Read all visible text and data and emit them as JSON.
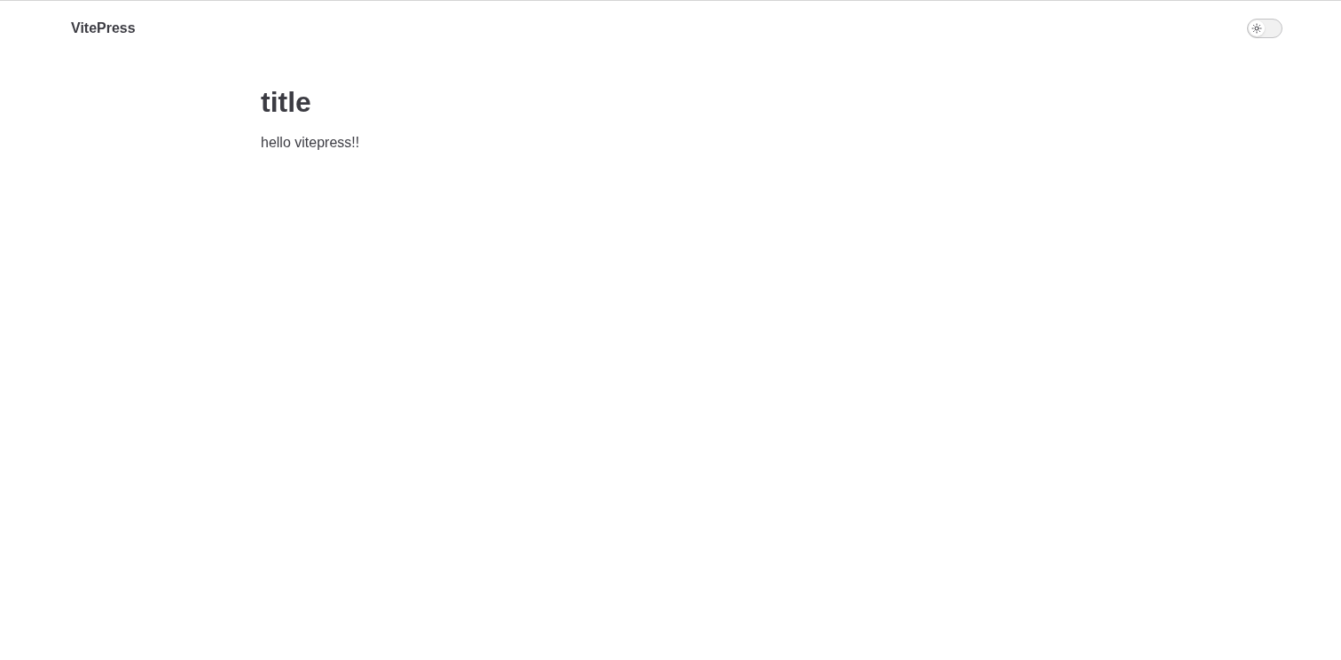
{
  "nav": {
    "site_title": "VitePress",
    "appearance_toggle": {
      "on": false
    }
  },
  "content": {
    "heading": "title",
    "paragraph": "hello vitepress!!"
  }
}
